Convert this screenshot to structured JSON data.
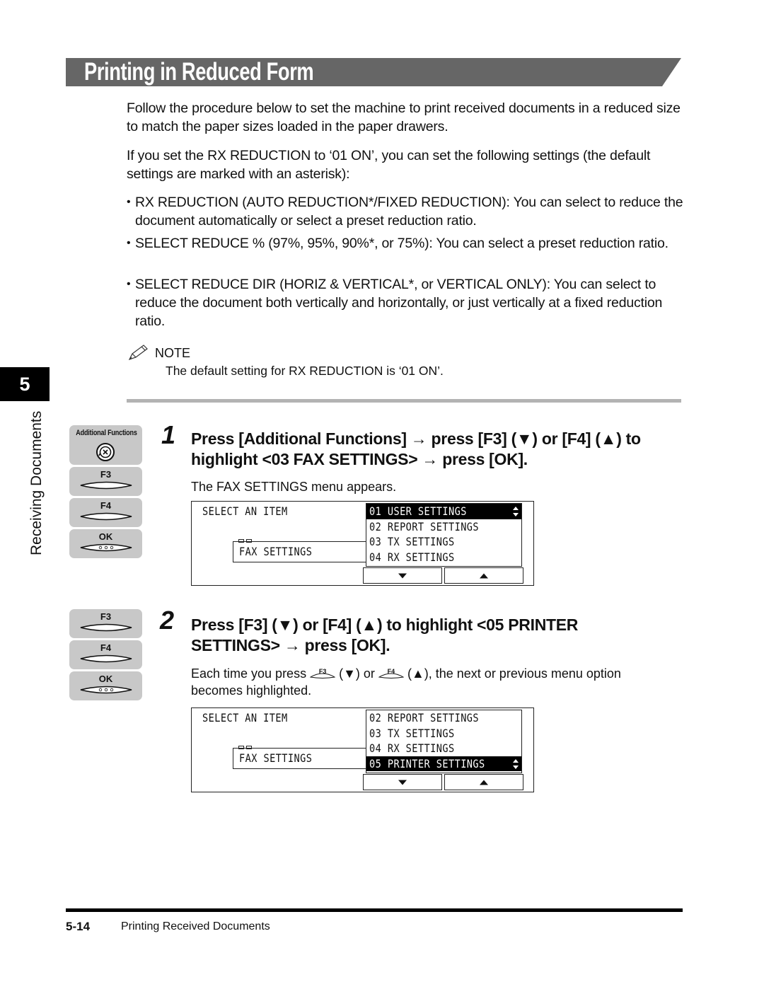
{
  "header": {
    "title": "Printing in Reduced Form",
    "bar_color": "#666666"
  },
  "intro": {
    "p1": "Follow the procedure below to set the machine to print received documents in a reduced size to match the paper sizes loaded in the paper drawers.",
    "p2": "If you set the RX REDUCTION to ‘01 ON’, you can set the following settings (the default settings are marked with an asterisk):"
  },
  "bullets": [
    {
      "text": "RX REDUCTION (AUTO REDUCTION*/FIXED REDUCTION): You can select to reduce the document automatically or select a preset reduction ratio."
    },
    {
      "text": "SELECT REDUCE % (97%, 95%, 90%*, or 75%): You can select a preset reduction ratio."
    },
    {
      "text": "SELECT REDUCE DIR (HORIZ & VERTICAL*, or VERTICAL ONLY): You can select to reduce the document both vertically and horizontally, or just vertically at a fixed reduction ratio."
    }
  ],
  "note": {
    "label": "NOTE",
    "icon": "pencil-icon",
    "text": "The default setting for RX REDUCTION is ‘01 ON’."
  },
  "chapter": {
    "number": "5",
    "title": "Receiving Documents"
  },
  "keys": {
    "additional_functions": "Additional Functions",
    "f3": "F3",
    "f4": "F4",
    "ok": "OK",
    "ok_dots": "○○○"
  },
  "steps": [
    {
      "number": "1",
      "title": "Press [Additional Functions] → press [F3] (▼) or [F4] (▲) to highlight <03 FAX SETTINGS> → press [OK].",
      "desc": "The FAX SETTINGS menu appears.",
      "lcd": {
        "heading": "SELECT AN ITEM",
        "current": "FAX SETTINGS",
        "items": [
          {
            "label": "01  USER SETTINGS",
            "selected": true
          },
          {
            "label": "02  REPORT SETTINGS",
            "selected": false
          },
          {
            "label": "03  TX SETTINGS",
            "selected": false
          },
          {
            "label": "04  RX SETTINGS",
            "selected": false
          }
        ]
      }
    },
    {
      "number": "2",
      "title": "Press [F3] (▼) or [F4] (▲) to highlight <05 PRINTER SETTINGS> → press [OK].",
      "desc_a": "Each time you press",
      "desc_b": "(▼) or",
      "desc_c": "(▲), the next or previous menu option",
      "desc_d": "becomes highlighted.",
      "lcd": {
        "heading": "SELECT AN ITEM",
        "current": "FAX SETTINGS",
        "items": [
          {
            "label": "02  REPORT SETTINGS",
            "selected": false
          },
          {
            "label": "03  TX SETTINGS",
            "selected": false
          },
          {
            "label": "04  RX SETTINGS",
            "selected": false
          },
          {
            "label": "05  PRINTER SETTINGS",
            "selected": true
          }
        ]
      }
    }
  ],
  "footer": {
    "page": "5-14",
    "section": "Printing Received Documents"
  }
}
